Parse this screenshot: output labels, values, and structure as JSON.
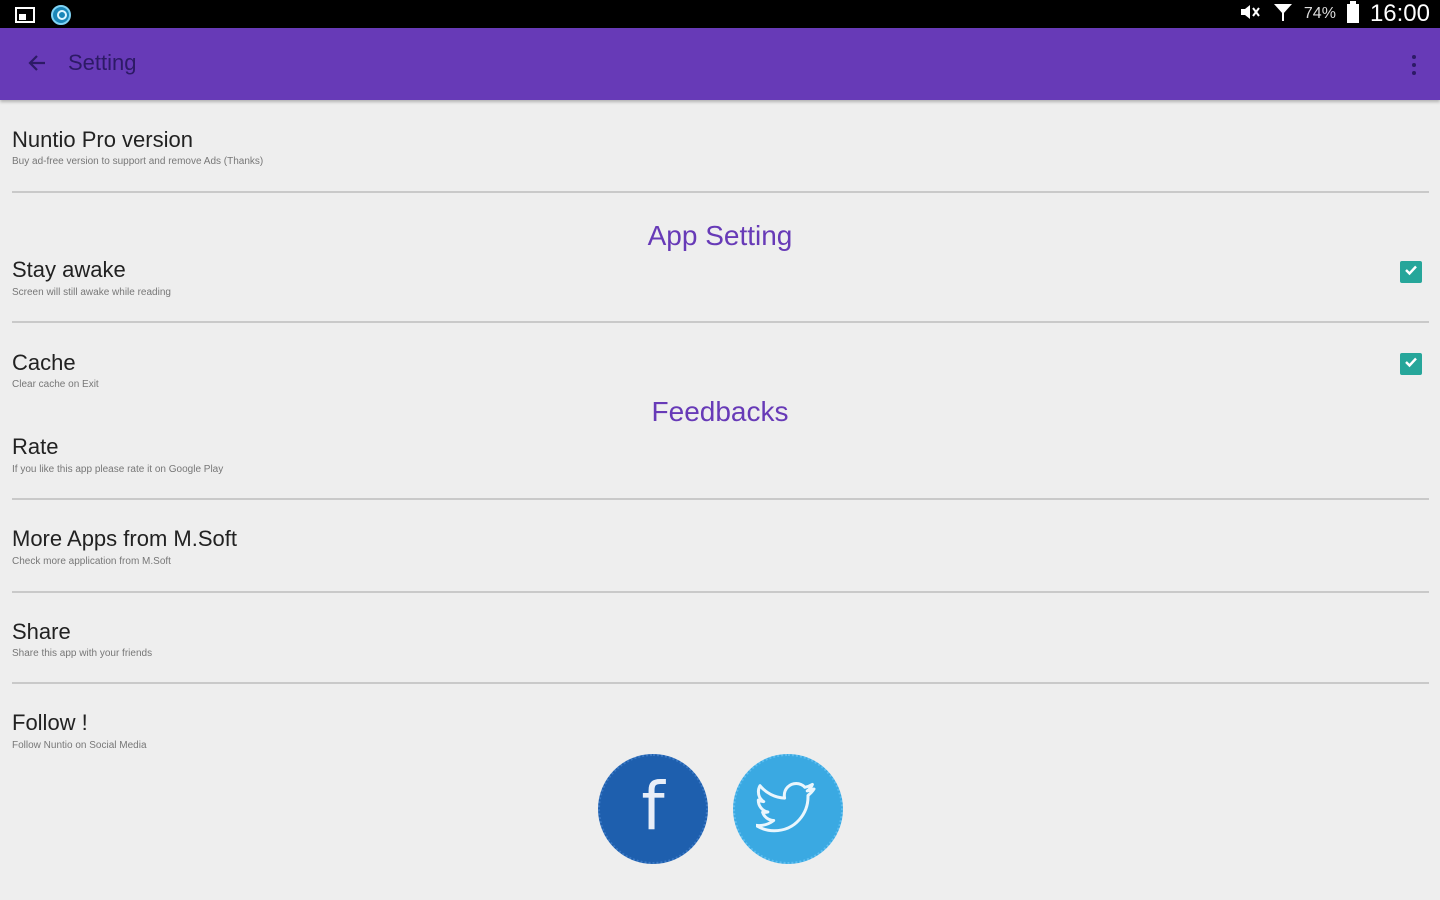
{
  "status_bar": {
    "battery_percent": "74%",
    "time": "16:00",
    "icons": [
      "screenshot-icon",
      "app-notification-icon",
      "mute-icon",
      "signal-icon",
      "battery-icon"
    ]
  },
  "app_bar": {
    "title": "Setting",
    "background_color": "#673ab7",
    "icons": [
      "back-arrow-icon",
      "overflow-menu-icon"
    ]
  },
  "preferences": {
    "pro_version": {
      "title": "Nuntio Pro version",
      "summary": "Buy ad-free version to support and remove Ads (Thanks)"
    },
    "app_setting_header": "App Setting",
    "stay_awake": {
      "title": "Stay awake",
      "summary": "Screen will still awake while reading",
      "checked": true
    },
    "cache": {
      "title": "Cache",
      "summary": "Clear cache on Exit",
      "checked": true
    },
    "feedbacks_header": "Feedbacks",
    "rate": {
      "title": "Rate",
      "summary": "If you like this app please rate it on Google Play"
    },
    "more_apps": {
      "title": "More Apps from M.Soft",
      "summary": "Check more application from M.Soft"
    },
    "share": {
      "title": "Share",
      "summary": "Share this app with your friends"
    },
    "follow": {
      "title": "Follow !",
      "summary": "Follow Nuntio on Social Media"
    }
  },
  "social": {
    "facebook_letter": "f",
    "facebook_color": "#1e5fae",
    "twitter_color": "#3aa9e2",
    "icons": [
      "facebook-icon",
      "twitter-bird-icon"
    ]
  },
  "accent_color": "#26a69a"
}
